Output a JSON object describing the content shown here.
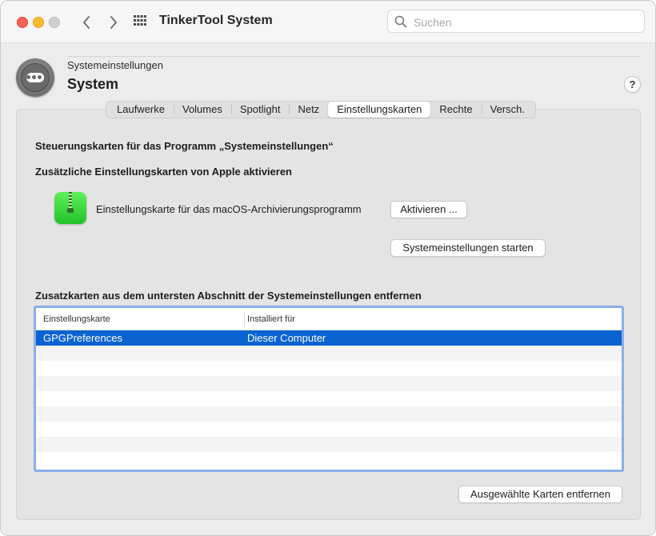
{
  "window": {
    "app_title": "TinkerTool System",
    "search_placeholder": "Suchen"
  },
  "header": {
    "parent": "Systemeinstellungen",
    "title": "System",
    "help_label": "?"
  },
  "tabs": [
    {
      "label": "Laufwerke",
      "active": false
    },
    {
      "label": "Volumes",
      "active": false
    },
    {
      "label": "Spotlight",
      "active": false
    },
    {
      "label": "Netz",
      "active": false
    },
    {
      "label": "Einstellungskarten",
      "active": true
    },
    {
      "label": "Rechte",
      "active": false
    },
    {
      "label": "Versch.",
      "active": false
    }
  ],
  "content": {
    "section1_heading": "Steuerungskarten für das Programm „Systemeinstellungen“",
    "section2_heading": "Zusätzliche Einstellungskarten von Apple aktivieren",
    "archive_card_label": "Einstellungskarte für das macOS-Archivierungsprogramm",
    "activate_button": "Aktivieren ...",
    "launch_button": "Systemeinstellungen starten",
    "section3_heading": "Zusatzkarten aus dem untersten Abschnitt der Systemeinstellungen entfernen",
    "remove_button": "Ausgewählte Karten entfernen"
  },
  "table": {
    "columns": [
      "Einstellungskarte",
      "Installiert für"
    ],
    "rows": [
      {
        "card": "GPGPreferences",
        "installed_for": "Dieser Computer",
        "selected": true
      }
    ]
  },
  "colors": {
    "accent": "#0a63d1",
    "focus_ring": "#8aaee8"
  }
}
